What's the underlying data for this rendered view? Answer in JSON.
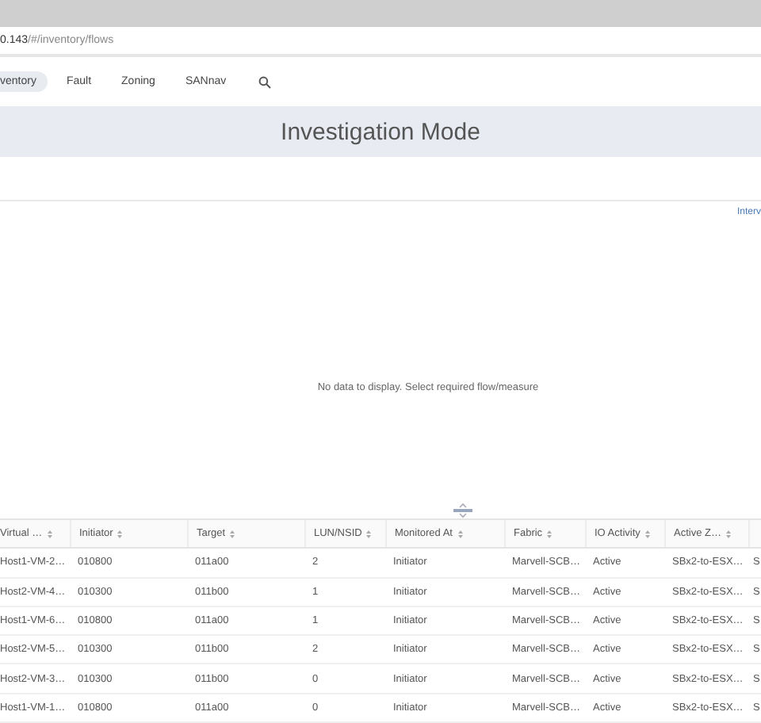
{
  "address_bar": {
    "host": "0.143",
    "path": "/#/inventory/flows"
  },
  "nav": {
    "tabs": [
      {
        "label": "ventory",
        "selected": true
      },
      {
        "label": "Fault",
        "selected": false
      },
      {
        "label": "Zoning",
        "selected": false
      },
      {
        "label": "SANnav",
        "selected": false
      }
    ]
  },
  "banner": {
    "title": "Investigation Mode"
  },
  "interval_link": "Interv",
  "empty_message": "No data to display. Select required flow/measure",
  "table": {
    "columns": [
      "Virtual …",
      "Initiator",
      "Target",
      "LUN/NSID",
      "Monitored At",
      "Fabric",
      "IO Activity",
      "Active Z…",
      ""
    ],
    "rows": [
      [
        "Host1-VM-2…",
        "010800",
        "011a00",
        "2",
        "Initiator",
        "Marvell-SCB…",
        "Active",
        "SBx2-to-ESX…",
        "S"
      ],
      [
        "Host2-VM-4…",
        "010300",
        "011b00",
        "1",
        "Initiator",
        "Marvell-SCB…",
        "Active",
        "SBx2-to-ESX…",
        "S"
      ],
      [
        "Host1-VM-6…",
        "010800",
        "011a00",
        "1",
        "Initiator",
        "Marvell-SCB…",
        "Active",
        "SBx2-to-ESX…",
        "S"
      ],
      [
        "Host2-VM-5…",
        "010300",
        "011b00",
        "2",
        "Initiator",
        "Marvell-SCB…",
        "Active",
        "SBx2-to-ESX…",
        "S"
      ],
      [
        "Host2-VM-3…",
        "010300",
        "011b00",
        "0",
        "Initiator",
        "Marvell-SCB…",
        "Active",
        "SBx2-to-ESX…",
        "S"
      ],
      [
        "Host1-VM-1…",
        "010800",
        "011a00",
        "0",
        "Initiator",
        "Marvell-SCB…",
        "Active",
        "SBx2-to-ESX…",
        "S"
      ]
    ]
  }
}
